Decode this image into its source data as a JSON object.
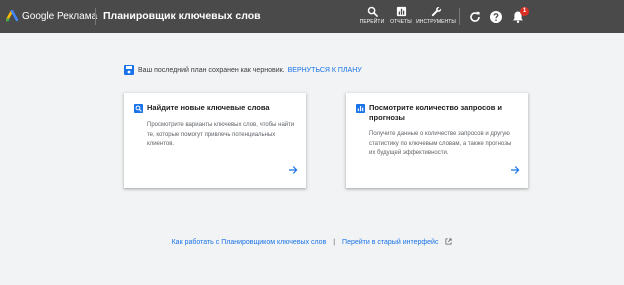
{
  "header": {
    "brand": "Google Реклама",
    "tool_title": "Планировщик ключевых слов",
    "nav": [
      {
        "label": "ПЕРЕЙТИ",
        "icon": "search-icon"
      },
      {
        "label": "ОТЧЕТЫ",
        "icon": "reports-icon"
      },
      {
        "label": "ИНСТРУМЕНТЫ",
        "icon": "wrench-icon"
      }
    ],
    "notification_count": "1",
    "colors": {
      "bar": "#4a4a4a",
      "badge": "#d93025"
    }
  },
  "draft_notice": {
    "message": "Ваш последний план сохранен как черновик.",
    "link": "ВЕРНУТЬСЯ К ПЛАНУ"
  },
  "cards": [
    {
      "title": "Найдите новые ключевые слова",
      "description": "Просмотрите варианты ключевых слов, чтобы найти те, которые помогут привлечь потенциальных клиентов.",
      "icon": "search-icon"
    },
    {
      "title": "Посмотрите количество запросов и прогнозы",
      "description": "Получите данные о количестве запросов и другую статистику по ключевым словам, а также прогнозы их будущей эффективности.",
      "icon": "chart-icon"
    }
  ],
  "footer": {
    "help_link": "Как работать с Планировщиком ключевых слов",
    "separator": "|",
    "old_ui_link": "Перейти в старый интерфейс"
  },
  "accent_color": "#1a73e8"
}
